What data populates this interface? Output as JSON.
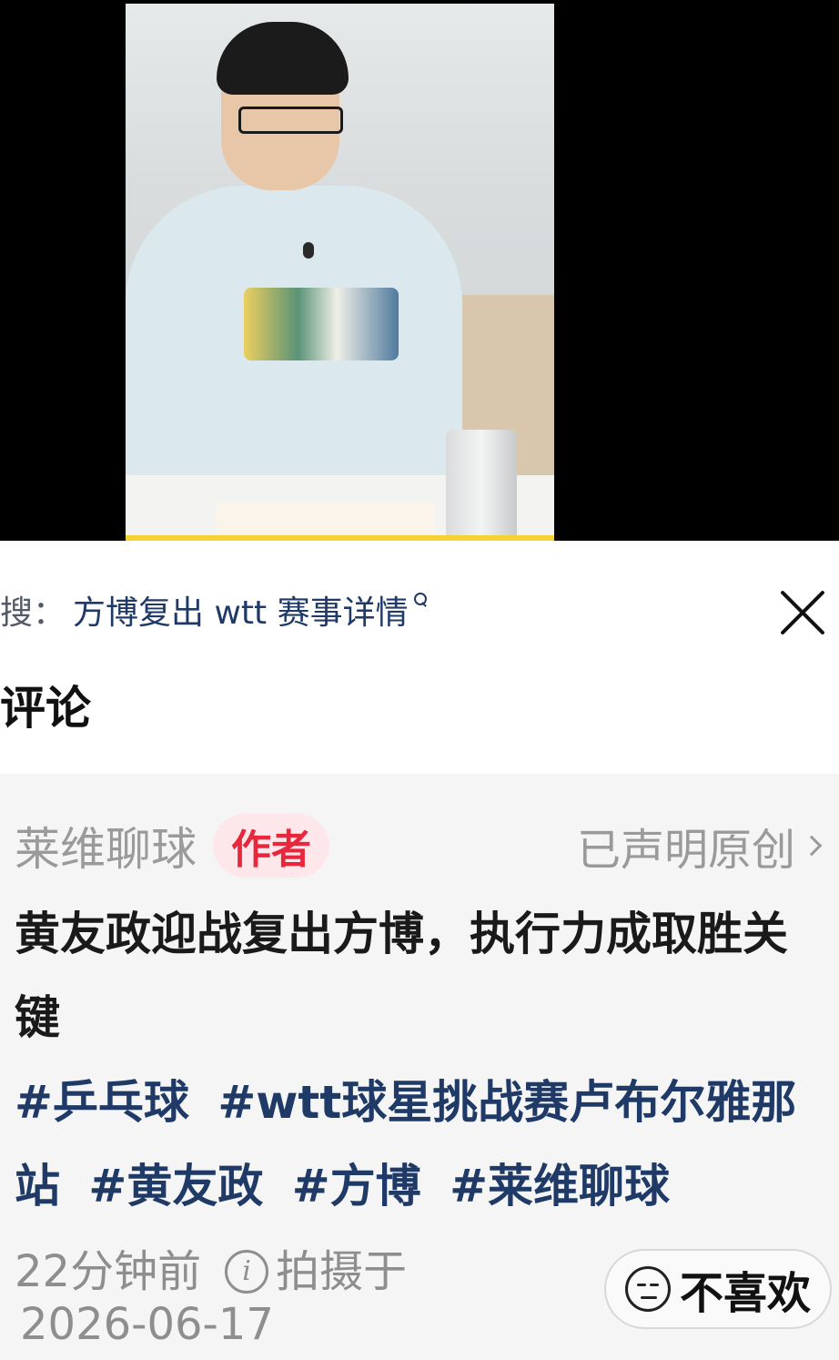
{
  "search": {
    "prefix": "搜：",
    "query": "方博复出 wtt 赛事详情"
  },
  "comments": {
    "title": "评论"
  },
  "author_post": {
    "author_name": "莱维聊球",
    "author_badge": "作者",
    "original_label": "已声明原创",
    "title": "黄友政迎战复出方博，执行力成取胜关键",
    "tags": [
      "#乒乓球",
      "#wtt球星挑战赛卢布尔雅那站",
      "#黄友政",
      "#方博",
      "#莱维聊球"
    ],
    "time_ago": "22分钟前",
    "shot_label": "拍摄于",
    "shot_date": "2026-06-17",
    "dislike_label": "不喜欢"
  },
  "colors": {
    "accent_link": "#1f3a66",
    "badge_text": "#e8263c",
    "badge_bg": "#fde7ea",
    "muted": "#9a9a9a"
  },
  "icons": [
    "search-icon",
    "close-icon",
    "chevron-right-icon",
    "info-icon",
    "neutral-face-icon"
  ]
}
